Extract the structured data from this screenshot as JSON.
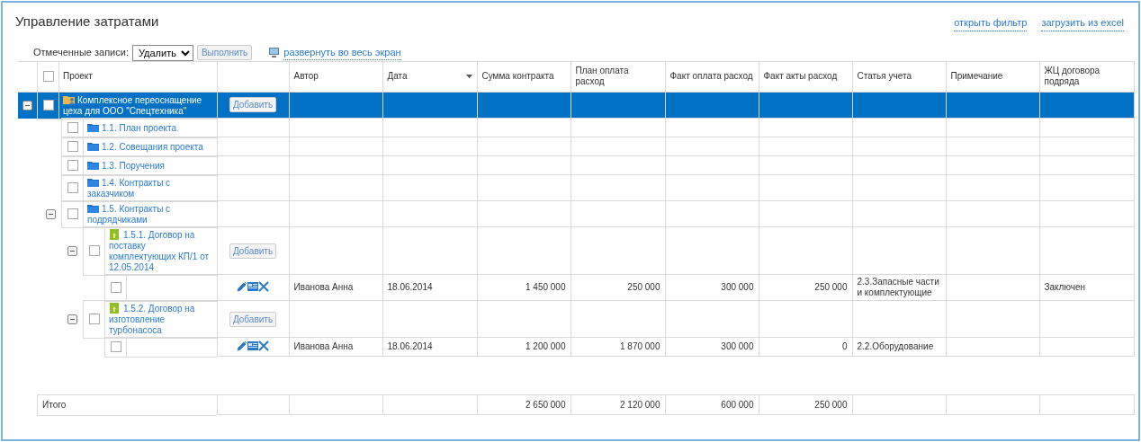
{
  "page": {
    "title": "Управление затратами",
    "links": [
      "открыть фильтр",
      "загрузить из excel"
    ]
  },
  "toolbar": {
    "label": "Отмеченные записи:",
    "action_select": "Удалить",
    "execute_button": "Выполнить",
    "fullscreen_link": "развернуть во весь экран"
  },
  "table": {
    "header_checkbox": {
      "checked": false
    },
    "columns": [
      {
        "label": "Проект",
        "sorted": false
      },
      {
        "label": "Автор",
        "sorted": false
      },
      {
        "label": "Дата",
        "sorted": true
      },
      {
        "label": "Сумма контракта",
        "sorted": false
      },
      {
        "label": "План оплата расход",
        "sorted": false
      },
      {
        "label": "Факт оплата расход",
        "sorted": false
      },
      {
        "label": "Факт акты расход",
        "sorted": false
      },
      {
        "label": "Статья учета",
        "sorted": false
      },
      {
        "label": "Примечание",
        "sorted": false
      },
      {
        "label": "ЖЦ договора подряда",
        "sorted": false
      }
    ],
    "rows": [
      {
        "kind": "project",
        "name": "Комплексное переоснащение цеха для ООО \"Спецтехника\"",
        "add_button": "Добавить",
        "expanded": true,
        "checked": false,
        "selected": true,
        "children": [
          {
            "kind": "folder",
            "name": "1.1. План проекта",
            "checked": false,
            "selected": false
          },
          {
            "kind": "folder",
            "name": "1.2. Совещания проекта",
            "checked": false,
            "selected": false
          },
          {
            "kind": "folder",
            "name": "1.3. Поручения",
            "checked": false,
            "selected": false
          },
          {
            "kind": "folder",
            "name": "1.4. Контракты с заказчиком",
            "checked": false,
            "selected": false
          },
          {
            "kind": "folder",
            "name": "1.5. Контракты с подрядчиками",
            "expanded": true,
            "checked": false,
            "selected": false,
            "children": [
              {
                "kind": "contract",
                "name": "1.5.1. Договор на поставку комплектующих КП/1 от 12.05.2014",
                "add_button": "Добавить",
                "expanded": true,
                "checked": false,
                "selected": false,
                "children": [
                  {
                    "kind": "entry",
                    "checked": false,
                    "selected": false,
                    "author": "Иванова Анна",
                    "date": "18.06.2014",
                    "contract_sum": "1 450 000",
                    "plan_payment": "250 000",
                    "fact_payment": "300 000",
                    "fact_acts": "250 000",
                    "account_item": "2.3.Запасные части и комплектующие",
                    "lifecycle": "Заключен"
                  }
                ]
              },
              {
                "kind": "contract",
                "name": "1.5.2. Договор на изготовление турбонасоса",
                "add_button": "Добавить",
                "expanded": true,
                "checked": false,
                "selected": false,
                "children": [
                  {
                    "kind": "entry",
                    "checked": false,
                    "selected": false,
                    "author": "Иванова Анна",
                    "date": "18.06.2014",
                    "contract_sum": "1 200 000",
                    "plan_payment": "1 870 000",
                    "fact_payment": "300 000",
                    "fact_acts": "0",
                    "account_item": "2.2.Оборудование"
                  }
                ]
              }
            ]
          }
        ]
      }
    ],
    "totals": {
      "label": "Итого",
      "contract_sum": "2 650 000",
      "plan_payment": "2 120 000",
      "fact_payment": "600 000",
      "fact_acts": "250 000"
    }
  }
}
